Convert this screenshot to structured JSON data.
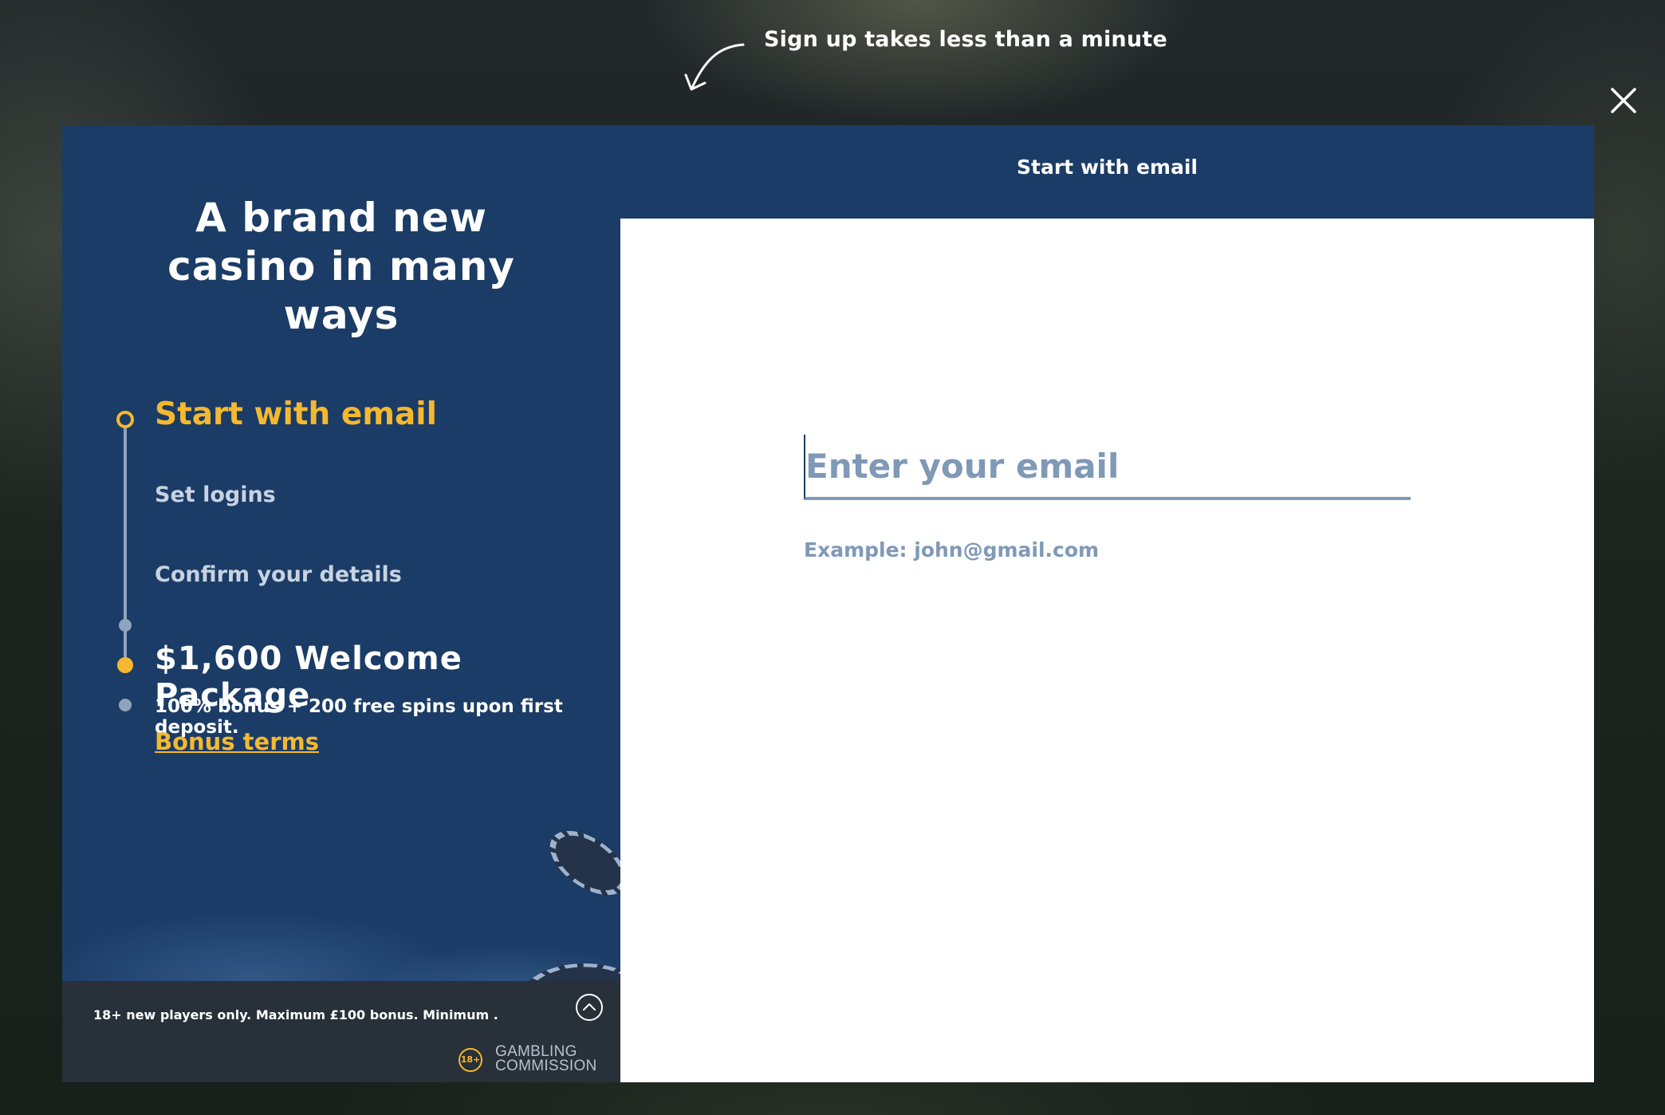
{
  "hint": {
    "text": "Sign up takes less than a minute",
    "arrow_icon": "curved-arrow-icon"
  },
  "close_icon": "close-icon",
  "left_panel": {
    "headline": [
      "A brand new",
      "casino in many",
      "ways"
    ],
    "steps": [
      {
        "label": "Start with email",
        "state": "active"
      },
      {
        "label": "Set logins",
        "state": "pending"
      },
      {
        "label": "Confirm your details",
        "state": "pending"
      },
      {
        "label": "$1,600 Welcome Package",
        "state": "reward"
      }
    ],
    "bonus_text": "100% bonus + 200 free spins upon first deposit.",
    "bonus_link": "Bonus terms",
    "footer": {
      "terms_text": "18+ new players only. Maximum £100 bonus. Minimum .",
      "badge": "18+",
      "commission": [
        "GAMBLING",
        "COMMISSION"
      ]
    }
  },
  "right_panel": {
    "title": "Start with email",
    "email": {
      "placeholder": "Enter your email",
      "value": "",
      "hint": "Example: john@gmail.com"
    }
  },
  "colors": {
    "navy": "#1b3c66",
    "gold": "#f5b82e",
    "muted": "#7f99b6"
  }
}
